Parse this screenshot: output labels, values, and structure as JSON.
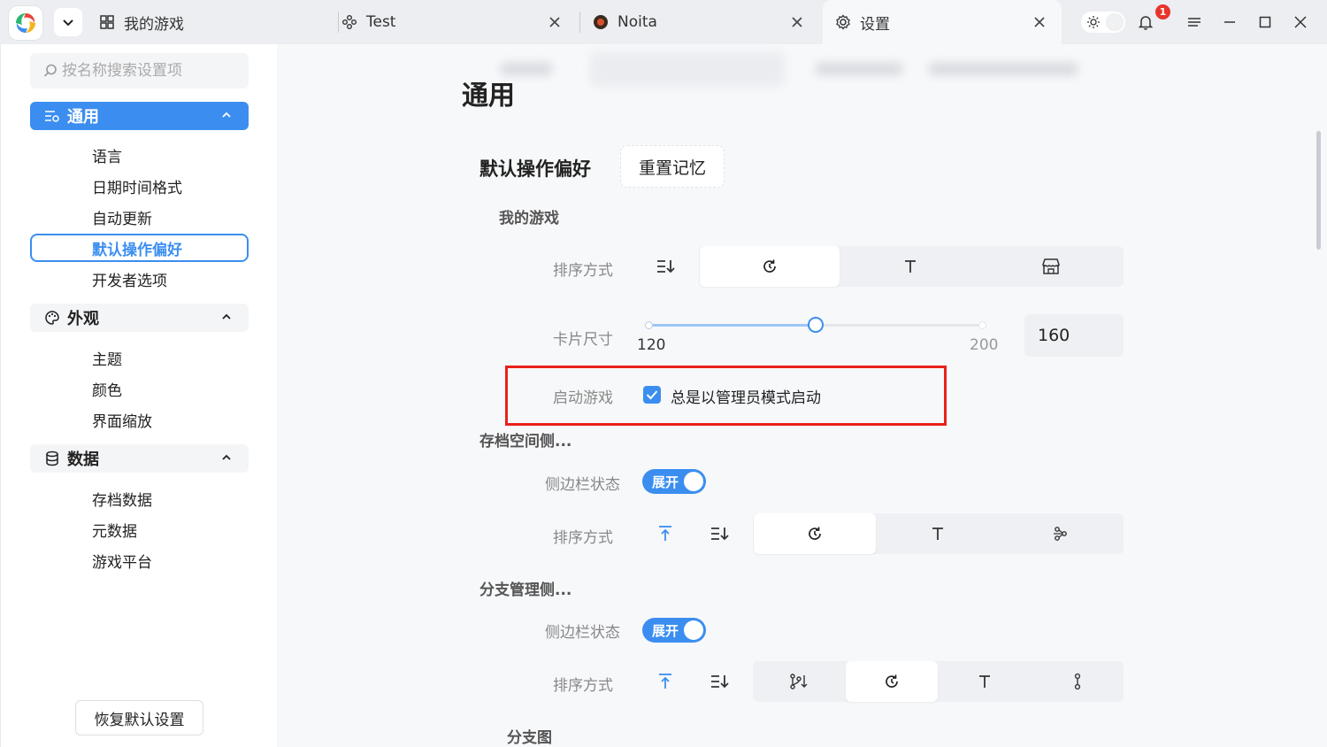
{
  "titlebar": {
    "tabs": [
      {
        "label": "我的游戏",
        "icon": "grid-icon"
      },
      {
        "label": "Test",
        "icon": "gamepad-icon"
      },
      {
        "label": "Noita",
        "icon": "game-logo-icon"
      },
      {
        "label": "设置",
        "icon": "gear-icon"
      }
    ],
    "notification_count": "1"
  },
  "sidebar": {
    "search_placeholder": "按名称搜索设置项",
    "groups": [
      {
        "label": "通用",
        "icon": "sliders-icon",
        "items": [
          "语言",
          "日期时间格式",
          "自动更新",
          "默认操作偏好",
          "开发者选项"
        ]
      },
      {
        "label": "外观",
        "icon": "palette-icon",
        "items": [
          "主题",
          "颜色",
          "界面缩放"
        ]
      },
      {
        "label": "数据",
        "icon": "database-icon",
        "items": [
          "存档数据",
          "元数据",
          "游戏平台"
        ]
      }
    ],
    "restore_label": "恢复默认设置"
  },
  "main": {
    "page_title": "通用",
    "section_title": "默认操作偏好",
    "reset_memory_label": "重置记忆",
    "my_games": {
      "heading": "我的游戏",
      "sort_label": "排序方式",
      "card_size_label": "卡片尺寸",
      "slider_min": "120",
      "slider_max": "200",
      "card_size_value": "160",
      "card_size_fraction": 0.5,
      "launch_label": "启动游戏",
      "launch_admin_label": "总是以管理员模式启动",
      "launch_admin_checked": true
    },
    "saves_side": {
      "heading": "存档空间侧...",
      "sidebar_state_label": "侧边栏状态",
      "toggle_text": "展开",
      "sort_label": "排序方式"
    },
    "branch_side": {
      "heading": "分支管理侧...",
      "sidebar_state_label": "侧边栏状态",
      "toggle_text": "展开",
      "sort_label": "排序方式"
    },
    "branch_graph_heading": "分支图"
  },
  "colors": {
    "accent": "#3b8ef0",
    "highlight": "#e8211a"
  }
}
